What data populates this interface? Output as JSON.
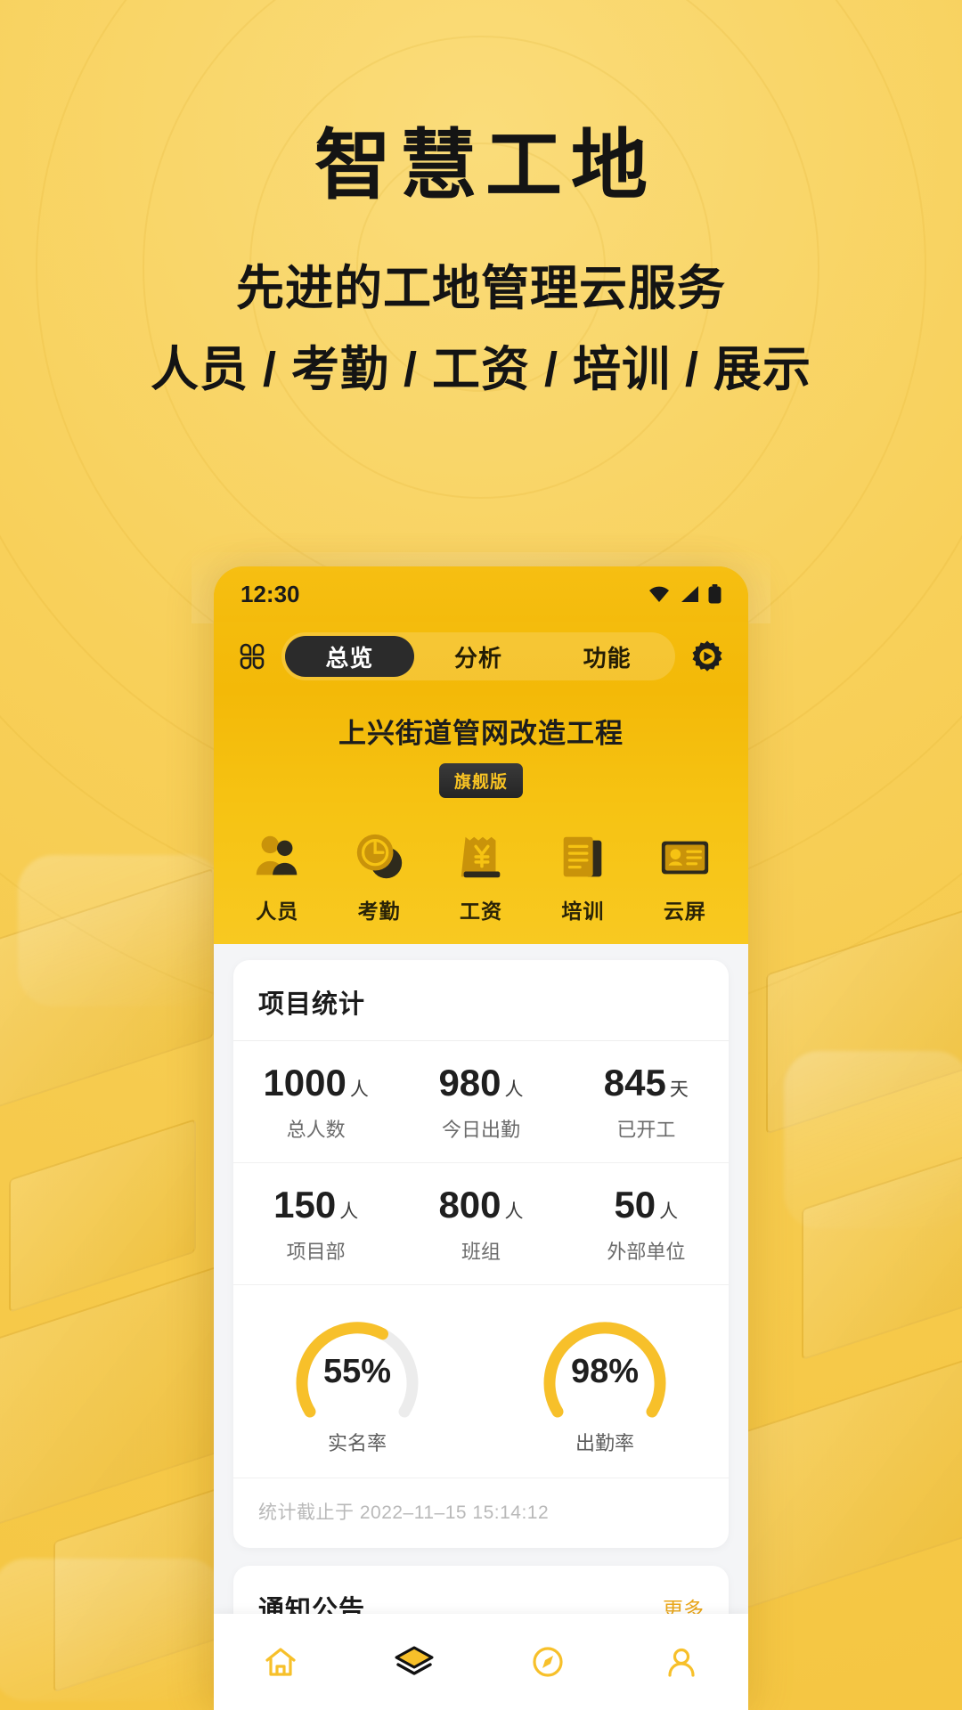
{
  "poster": {
    "title": "智慧工地",
    "subtitle_line1": "先进的工地管理云服务",
    "subtitle_line2": "人员 / 考勤 / 工资 / 培训 / 展示",
    "background_color": "#f8d05a"
  },
  "phone": {
    "status_bar": {
      "time": "12:30",
      "icons": [
        "wifi-icon",
        "signal-icon",
        "battery-icon"
      ]
    },
    "top_bar": {
      "grid_icon": "grid-icon",
      "gear_icon": "gear-icon",
      "tabs": [
        {
          "label": "总览",
          "active": true
        },
        {
          "label": "分析",
          "active": false
        },
        {
          "label": "功能",
          "active": false
        }
      ]
    },
    "project": {
      "name": "上兴街道管网改造工程",
      "badge": "旗舰版"
    },
    "shortcuts": [
      {
        "label": "人员",
        "icon": "people-icon"
      },
      {
        "label": "考勤",
        "icon": "attendance-clock-icon"
      },
      {
        "label": "工资",
        "icon": "payroll-receipt-icon"
      },
      {
        "label": "培训",
        "icon": "training-book-icon"
      },
      {
        "label": "云屏",
        "icon": "cloud-screen-icon"
      }
    ],
    "stats_card": {
      "title": "项目统计",
      "rows": [
        [
          {
            "value": "1000",
            "unit": "人",
            "label": "总人数"
          },
          {
            "value": "980",
            "unit": "人",
            "label": "今日出勤"
          },
          {
            "value": "845",
            "unit": "天",
            "label": "已开工"
          }
        ],
        [
          {
            "value": "150",
            "unit": "人",
            "label": "项目部"
          },
          {
            "value": "800",
            "unit": "人",
            "label": "班组"
          },
          {
            "value": "50",
            "unit": "人",
            "label": "外部单位"
          }
        ]
      ],
      "gauges": [
        {
          "value": "55%",
          "percent": 55,
          "label": "实名率"
        },
        {
          "value": "98%",
          "percent": 98,
          "label": "出勤率"
        }
      ],
      "footnote": "统计截止于 2022–11–15 15:14:12"
    },
    "notice_card": {
      "title": "通知公告",
      "more": "更多"
    },
    "bottom_nav": [
      {
        "icon": "home-icon",
        "active": false
      },
      {
        "icon": "layers-icon",
        "active": true
      },
      {
        "icon": "compass-icon",
        "active": false
      },
      {
        "icon": "user-icon",
        "active": false
      }
    ],
    "colors": {
      "accent": "#f7c02a",
      "header_yellow": "#f3b908",
      "dark": "#2b2b2b",
      "body_bg": "#f4f5f7"
    }
  },
  "chart_data": {
    "type": "pie",
    "title": "项目统计",
    "series": [
      {
        "name": "实名率",
        "value": 55,
        "max": 100,
        "unit": "%"
      },
      {
        "name": "出勤率",
        "value": 98,
        "max": 100,
        "unit": "%"
      }
    ],
    "categories": [
      "总人数",
      "今日出勤",
      "已开工",
      "项目部",
      "班组",
      "外部单位"
    ],
    "values": [
      1000,
      980,
      845,
      150,
      800,
      50
    ],
    "units": [
      "人",
      "人",
      "天",
      "人",
      "人",
      "人"
    ],
    "annotations": [
      "统计截止于 2022–11–15 15:14:12"
    ]
  }
}
